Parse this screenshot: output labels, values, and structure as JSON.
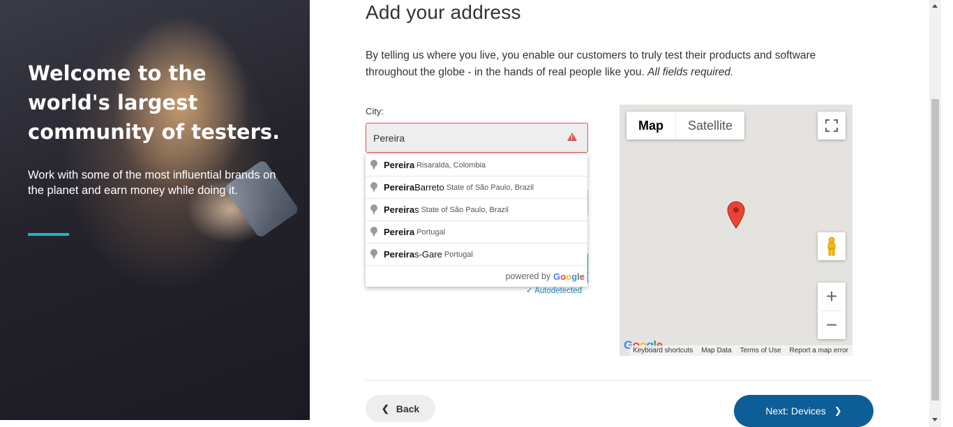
{
  "hero": {
    "heading": "Welcome to the world's largest community of testers.",
    "subtext": "Work with some of the most influential brands on the planet and earn money while doing it.",
    "accent_color": "#1fb3c7"
  },
  "page": {
    "title": "Add your address",
    "intro": "By telling us where you live, you enable our customers to truly test their products and software throughout the globe - in the hands of real people like you.",
    "intro_note": "All fields required."
  },
  "city": {
    "label": "City:",
    "value": "Pereira",
    "error_color": "#d9534f"
  },
  "autocomplete": {
    "items": [
      {
        "match": "Pereira",
        "rest": "",
        "secondary": "Risaralda, Colombia"
      },
      {
        "match": "Pereira",
        "rest": " Barreto",
        "secondary": "State of São Paulo, Brazil"
      },
      {
        "match": "Pereira",
        "rest": "s",
        "secondary": "State of São Paulo, Brazil"
      },
      {
        "match": "Pereira",
        "rest": "",
        "secondary": "Portugal"
      },
      {
        "match": "Pereira",
        "rest": "s-Gare",
        "secondary": "Portugal"
      }
    ],
    "powered_by": "powered by",
    "google": "Google"
  },
  "autodetected": "Autodetected",
  "map": {
    "type_map": "Map",
    "type_satellite": "Satellite",
    "zoom_in": "+",
    "zoom_out": "−",
    "logo": "Google",
    "attribution": [
      "Keyboard shortcuts",
      "Map Data",
      "Terms of Use",
      "Report a map error"
    ],
    "marker_color": "#ea4335"
  },
  "nav": {
    "back": "Back",
    "next": "Next: Devices",
    "next_color": "#0d5e96"
  }
}
